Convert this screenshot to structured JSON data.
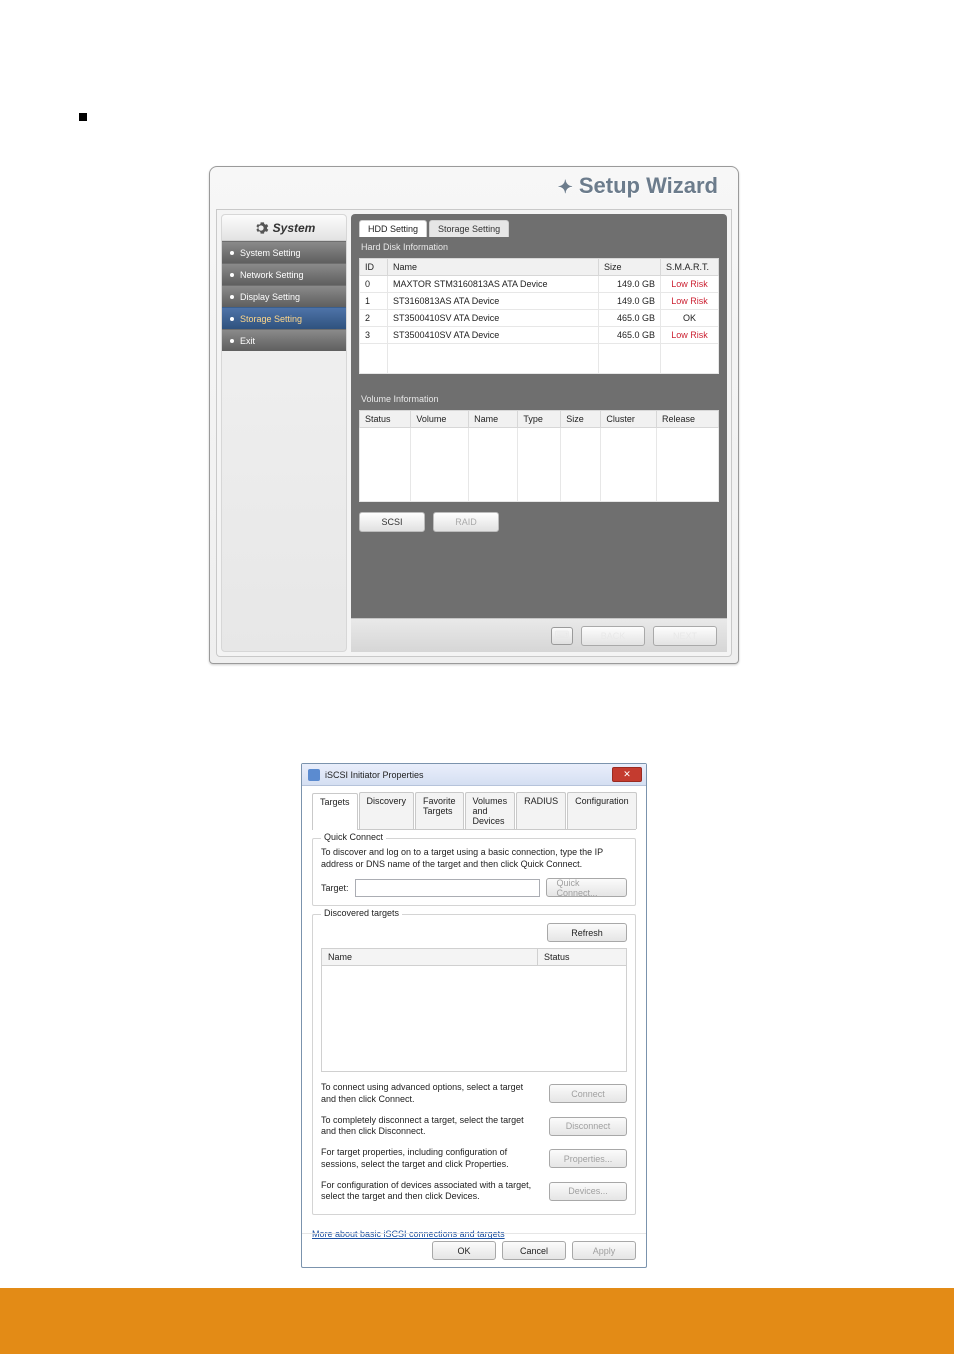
{
  "setup_wizard": {
    "title": "Setup Wizard",
    "sidebar": {
      "header": "System",
      "items": [
        {
          "label": "System Setting",
          "active": false
        },
        {
          "label": "Network Setting",
          "active": false
        },
        {
          "label": "Display Setting",
          "active": false
        },
        {
          "label": "Storage Setting",
          "active": true
        },
        {
          "label": "Exit",
          "active": false
        }
      ]
    },
    "tabs": {
      "hdd": "HDD Setting",
      "storage": "Storage Setting"
    },
    "hdd_section_title": "Hard Disk Information",
    "hdd_headers": {
      "id": "ID",
      "name": "Name",
      "size": "Size",
      "smart": "S.M.A.R.T."
    },
    "hdd_rows": [
      {
        "id": "0",
        "name": "MAXTOR STM3160813AS ATA Device",
        "size": "149.0 GB",
        "smart": "Low Risk",
        "risk": true
      },
      {
        "id": "1",
        "name": "ST3160813AS ATA Device",
        "size": "149.0 GB",
        "smart": "Low Risk",
        "risk": true
      },
      {
        "id": "2",
        "name": "ST3500410SV ATA Device",
        "size": "465.0 GB",
        "smart": "OK",
        "risk": false
      },
      {
        "id": "3",
        "name": "ST3500410SV ATA Device",
        "size": "465.0 GB",
        "smart": "Low Risk",
        "risk": true
      }
    ],
    "vol_section_title": "Volume Information",
    "vol_headers": {
      "status": "Status",
      "volume": "Volume",
      "name": "Name",
      "type": "Type",
      "size": "Size",
      "cluster": "Cluster",
      "release": "Release"
    },
    "buttons": {
      "scsi": "SCSI",
      "raid": "RAID",
      "back": "BACK",
      "next": "NEXT"
    }
  },
  "iscsi": {
    "title": "iSCSI Initiator Properties",
    "tabs": {
      "targets": "Targets",
      "discovery": "Discovery",
      "favorite": "Favorite Targets",
      "volumes": "Volumes and Devices",
      "radius": "RADIUS",
      "config": "Configuration"
    },
    "quick_connect": {
      "legend": "Quick Connect",
      "text": "To discover and log on to a target using a basic connection, type the IP address or DNS name of the target and then click Quick Connect.",
      "target_label": "Target:",
      "button": "Quick Connect..."
    },
    "discovered": {
      "legend": "Discovered targets",
      "refresh": "Refresh",
      "name_header": "Name",
      "status_header": "Status"
    },
    "actions": {
      "connect_text": "To connect using advanced options, select a target and then click Connect.",
      "connect_btn": "Connect",
      "disconnect_text": "To completely disconnect a target, select the target and then click Disconnect.",
      "disconnect_btn": "Disconnect",
      "properties_text": "For target properties, including configuration of sessions, select the target and click Properties.",
      "properties_btn": "Properties...",
      "devices_text": "For configuration of devices associated with a target, select the target and then click Devices.",
      "devices_btn": "Devices..."
    },
    "link": "More about basic iSCSI connections and targets",
    "foot": {
      "ok": "OK",
      "cancel": "Cancel",
      "apply": "Apply"
    }
  }
}
